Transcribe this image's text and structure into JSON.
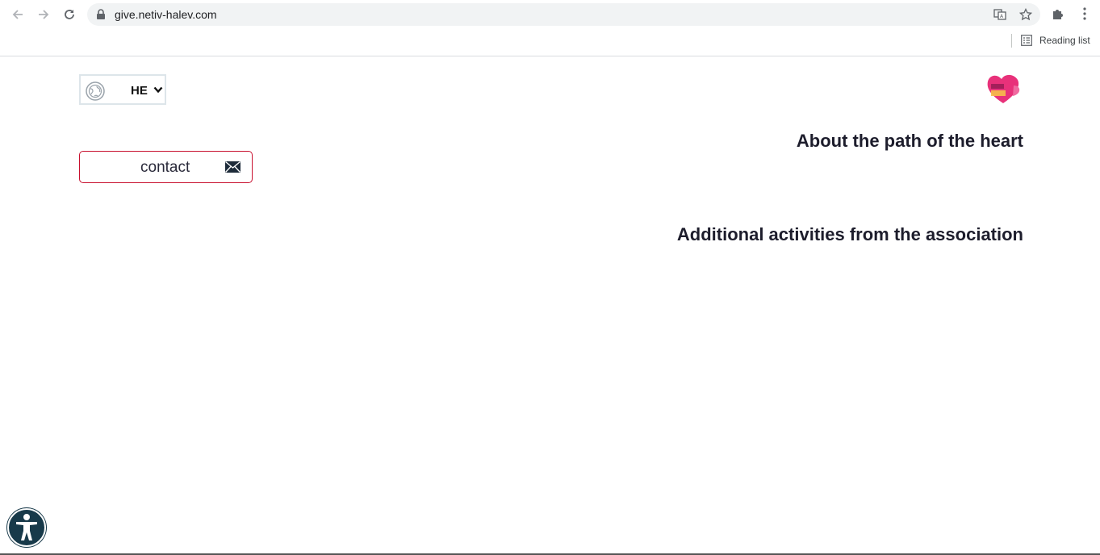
{
  "browser": {
    "url": "give.netiv-halev.com",
    "reading_list_label": "Reading list"
  },
  "header": {
    "language_code": "HE"
  },
  "main": {
    "about_heading": "About the path of the heart",
    "activities_heading": "Additional activities from the association",
    "contact_label": "contact"
  },
  "colors": {
    "contact_border": "#c8102e",
    "logo_pink": "#e8317a",
    "accessibility_bg": "#183a4a"
  }
}
